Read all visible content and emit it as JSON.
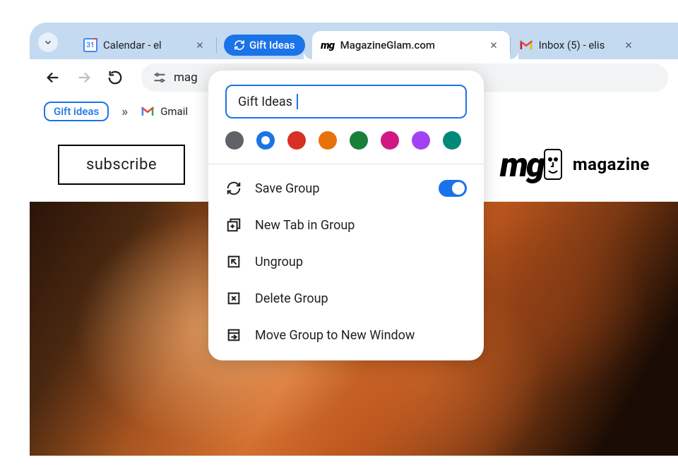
{
  "tabs": {
    "calendar": {
      "title": "Calendar - el"
    },
    "group_pill": {
      "label": "Gift Ideas"
    },
    "active": {
      "title": "MagazineGlam.com"
    },
    "inbox": {
      "title": "Inbox (5) - elis"
    }
  },
  "omnibox": {
    "text": "mag"
  },
  "bookmarks": {
    "group_label": "Gift ideas",
    "gmail_label": "Gmail"
  },
  "page": {
    "subscribe": "subscribe",
    "brand_logo": "mg",
    "brand_text": "magazine"
  },
  "popup": {
    "name_value": "Gift Ideas",
    "colors": [
      {
        "hex": "#5f6368",
        "selected": false
      },
      {
        "hex": "#1a73e8",
        "selected": true
      },
      {
        "hex": "#d93025",
        "selected": false
      },
      {
        "hex": "#e8710a",
        "selected": false
      },
      {
        "hex": "#188038",
        "selected": false
      },
      {
        "hex": "#d01884",
        "selected": false
      },
      {
        "hex": "#a142f4",
        "selected": false
      },
      {
        "hex": "#00897b",
        "selected": false
      }
    ],
    "menu": {
      "save_group": "Save Group",
      "new_tab": "New Tab in Group",
      "ungroup": "Ungroup",
      "delete": "Delete Group",
      "move": "Move Group to New Window"
    }
  }
}
